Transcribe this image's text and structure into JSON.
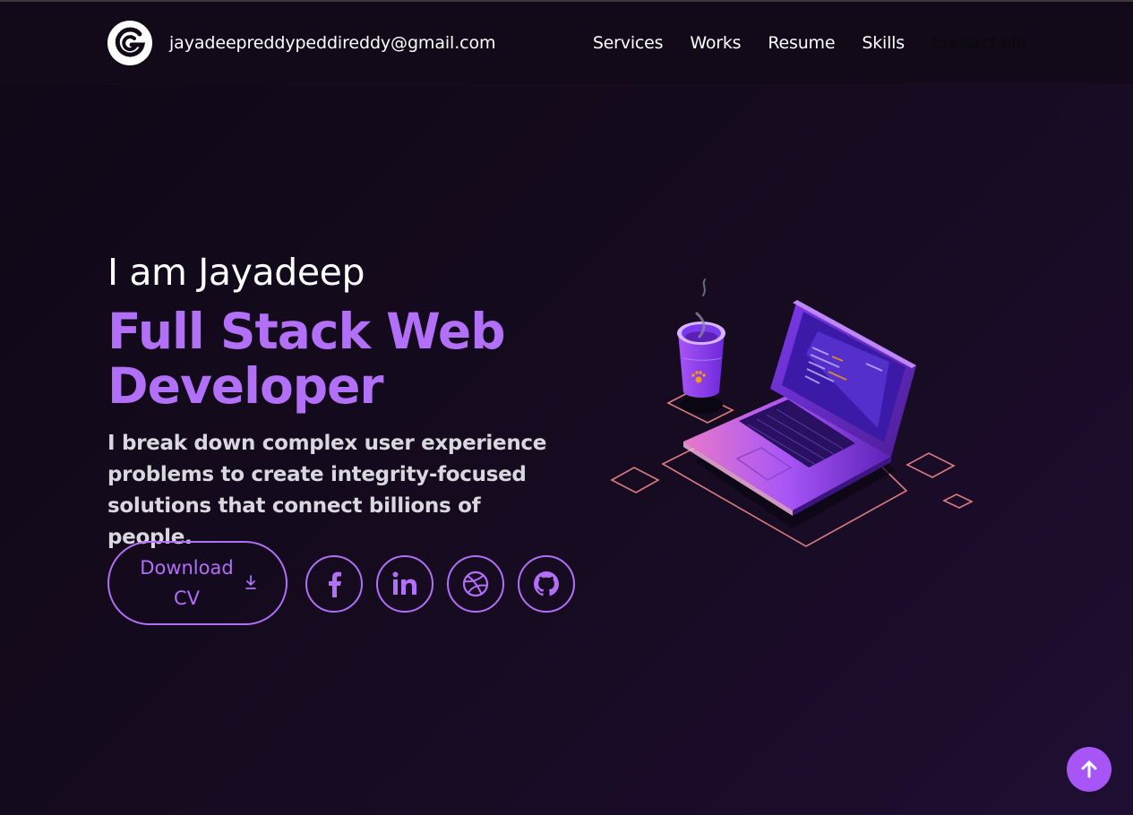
{
  "header": {
    "email": "jayadeepreddypeddireddy@gmail.com",
    "nav": [
      "Services",
      "Works",
      "Resume",
      "Skills",
      "Contact Me"
    ]
  },
  "hero": {
    "intro": "I am Jayadeep",
    "title": "Full Stack Web Developer",
    "description": "I break down complex user experience problems to create integrity-focused solutions that connect billions of people.",
    "cv_button": "Download CV"
  },
  "social_icons": [
    "facebook-icon",
    "linkedin-icon",
    "dribbble-icon",
    "github-icon"
  ],
  "colors": {
    "accent": "#b26ff7",
    "background": "#140a1e",
    "scroll_button": "#a855f7"
  }
}
